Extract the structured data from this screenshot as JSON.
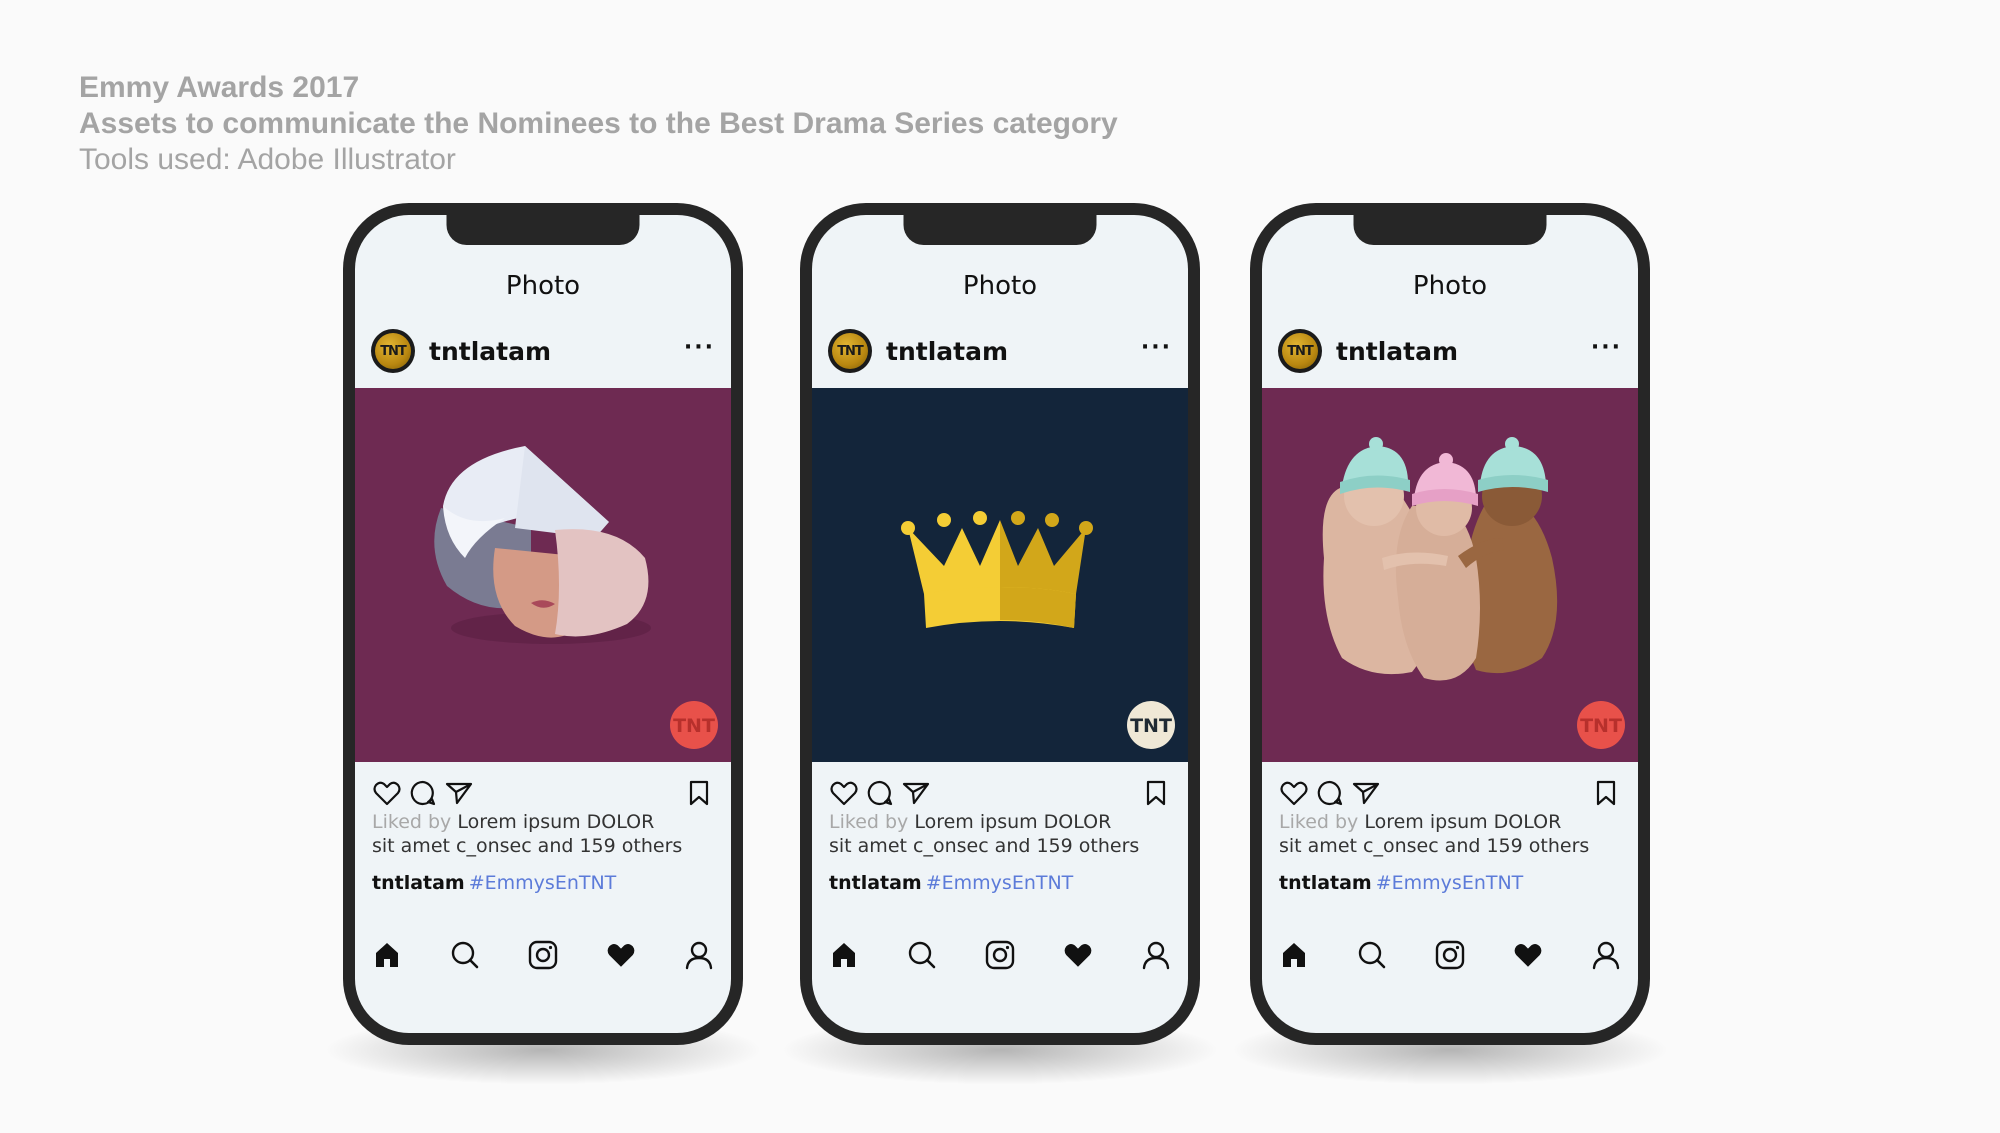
{
  "header": {
    "line1": "Emmy Awards 2017",
    "line2": "Assets to communicate the Nominees to the Best Drama Series category",
    "line3": "Tools used: Adobe Illustrator"
  },
  "phones": [
    {
      "title": "Photo",
      "username": "tntlatam",
      "avatar_text": "TNT",
      "more": "···",
      "photo": "handmaid-bonnet-illustration",
      "photo_bg": "#6e2a52",
      "badge_text": "TNT",
      "badge_color": "#e8514a",
      "liked_prefix": "Liked by",
      "liked_line1": "Lorem ipsum DOLOR",
      "liked_line2": "sit amet c_onsec and 159 others",
      "caption_user": "tntlatam",
      "caption_tag": "#EmmysEnTNT"
    },
    {
      "title": "Photo",
      "username": "tntlatam",
      "avatar_text": "TNT",
      "more": "···",
      "photo": "gold-crown-illustration",
      "photo_bg": "#13253a",
      "badge_text": "TNT",
      "badge_color": "#efe8d6",
      "liked_prefix": "Liked by",
      "liked_line1": "Lorem ipsum DOLOR",
      "liked_line2": "sit amet c_onsec and 159 others",
      "caption_user": "tntlatam",
      "caption_tag": "#EmmysEnTNT"
    },
    {
      "title": "Photo",
      "username": "tntlatam",
      "avatar_text": "TNT",
      "more": "···",
      "photo": "three-babies-illustration",
      "photo_bg": "#6e2a52",
      "badge_text": "TNT",
      "badge_color": "#e8514a",
      "liked_prefix": "Liked by",
      "liked_line1": "Lorem ipsum DOLOR",
      "liked_line2": "sit amet c_onsec and 159 others",
      "caption_user": "tntlatam",
      "caption_tag": "#EmmysEnTNT"
    }
  ],
  "icons": {
    "actions": [
      "heart-icon",
      "comment-icon",
      "share-icon",
      "bookmark-icon"
    ],
    "nav": [
      "home-icon",
      "search-icon",
      "instagram-icon",
      "heart-filled-icon",
      "profile-icon"
    ]
  }
}
